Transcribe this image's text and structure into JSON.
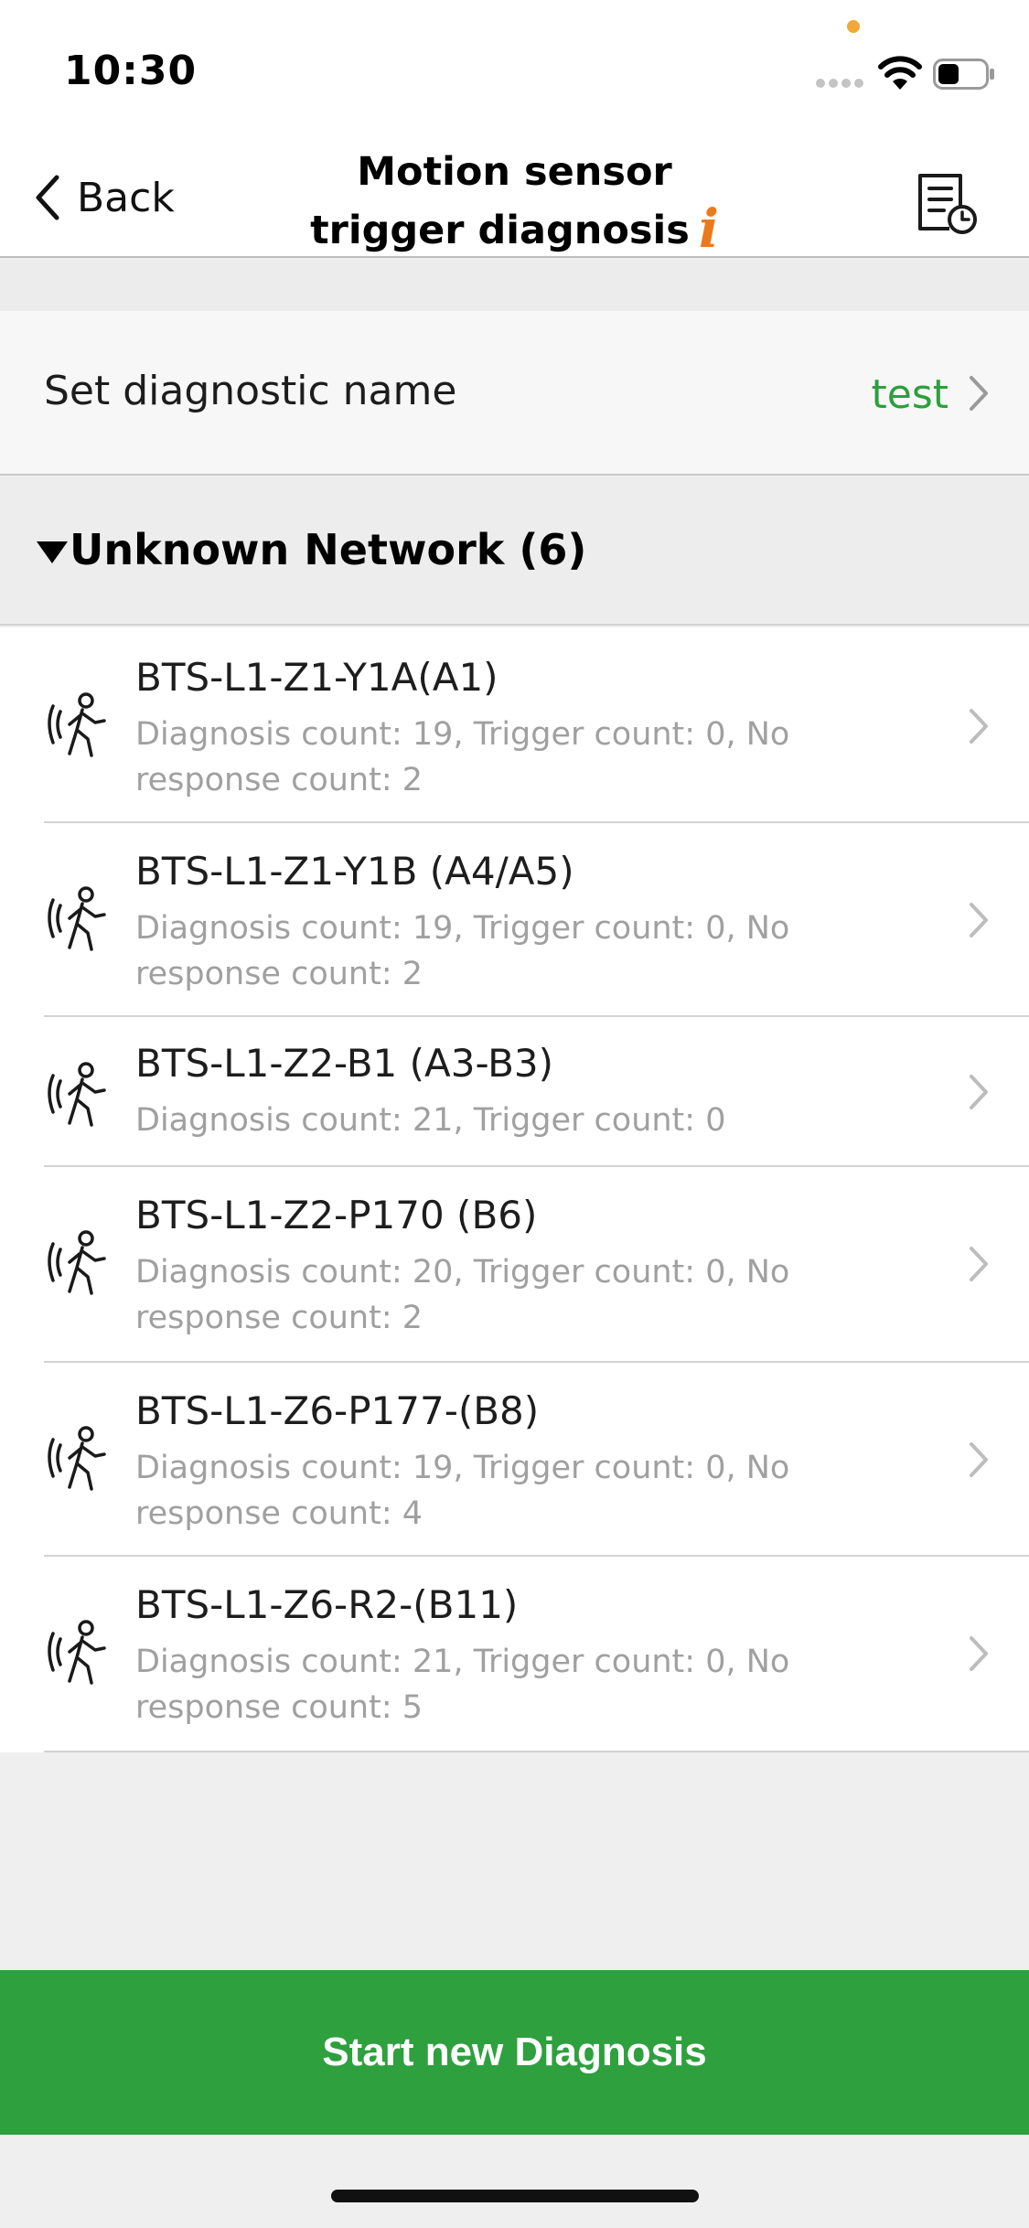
{
  "status_bar": {
    "time": "10:30"
  },
  "nav": {
    "back_label": "Back",
    "title_line1": "Motion sensor",
    "title_line2": "trigger diagnosis",
    "info_glyph": "i"
  },
  "diagnostic_name": {
    "label": "Set diagnostic name",
    "value": "test"
  },
  "section": {
    "title": "Unknown Network (6)"
  },
  "devices": [
    {
      "name": "BTS-L1-Z1-Y1A(A1)",
      "detail": "Diagnosis count: 19, Trigger count: 0, No response count: 2"
    },
    {
      "name": "BTS-L1-Z1-Y1B (A4/A5)",
      "detail": "Diagnosis count: 19, Trigger count: 0, No response count: 2"
    },
    {
      "name": "BTS-L1-Z2-B1 (A3-B3)",
      "detail": "Diagnosis count: 21, Trigger count: 0"
    },
    {
      "name": "BTS-L1-Z2-P170 (B6)",
      "detail": "Diagnosis count: 20, Trigger count: 0, No response count: 2"
    },
    {
      "name": "BTS-L1-Z6-P177-(B8)",
      "detail": "Diagnosis count: 19, Trigger count: 0, No response count: 4"
    },
    {
      "name": "BTS-L1-Z6-R2-(B11)",
      "detail": "Diagnosis count: 21, Trigger count: 0, No response count: 5"
    }
  ],
  "actions": {
    "start_label": "Start new Diagnosis"
  },
  "colors": {
    "accent_green": "#2ea03e",
    "value_green": "#2aa03c",
    "info_orange": "#ec7a1c"
  },
  "icons": {
    "back": "chevron-left-icon",
    "history": "report-history-icon",
    "device": "motion-sensor-person-icon",
    "row": "chevron-right-icon",
    "section": "caret-down-icon"
  }
}
